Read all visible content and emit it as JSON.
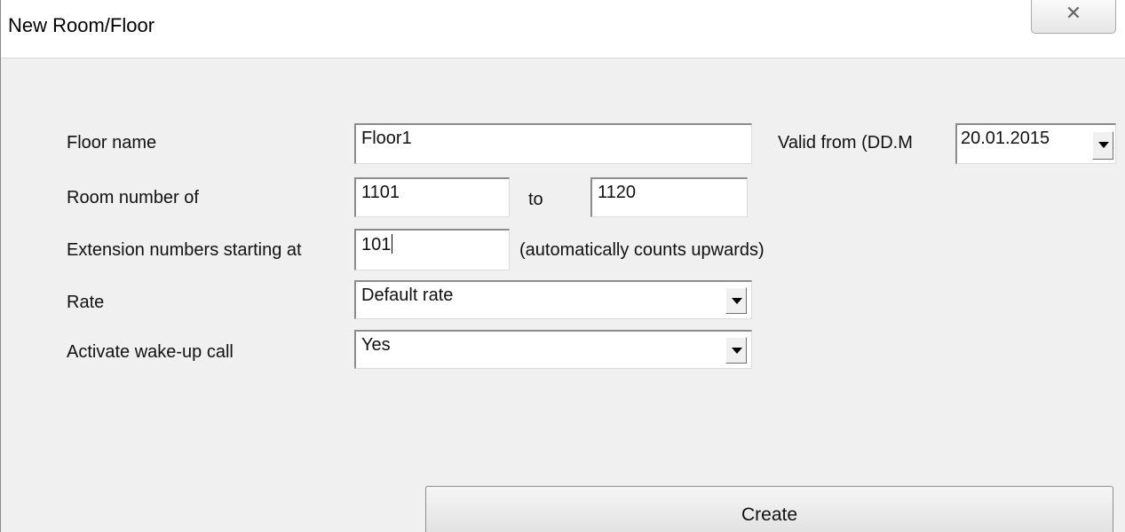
{
  "window": {
    "title": "New Room/Floor",
    "close_glyph": "☒"
  },
  "form": {
    "floor_name_label": "Floor name",
    "floor_name_value": "Floor1",
    "valid_from_label": "Valid from (DD.M",
    "valid_from_value": "20.01.2015",
    "room_number_label": "Room number of",
    "room_from_value": "1101",
    "to_label": "to",
    "room_to_value": "1120",
    "extension_label": "Extension numbers starting at",
    "extension_value": "101",
    "extension_hint": "(automatically counts upwards)",
    "rate_label": "Rate",
    "rate_value": "Default rate",
    "wakeup_label": "Activate wake-up call",
    "wakeup_value": "Yes"
  },
  "actions": {
    "create_label": "Create"
  }
}
